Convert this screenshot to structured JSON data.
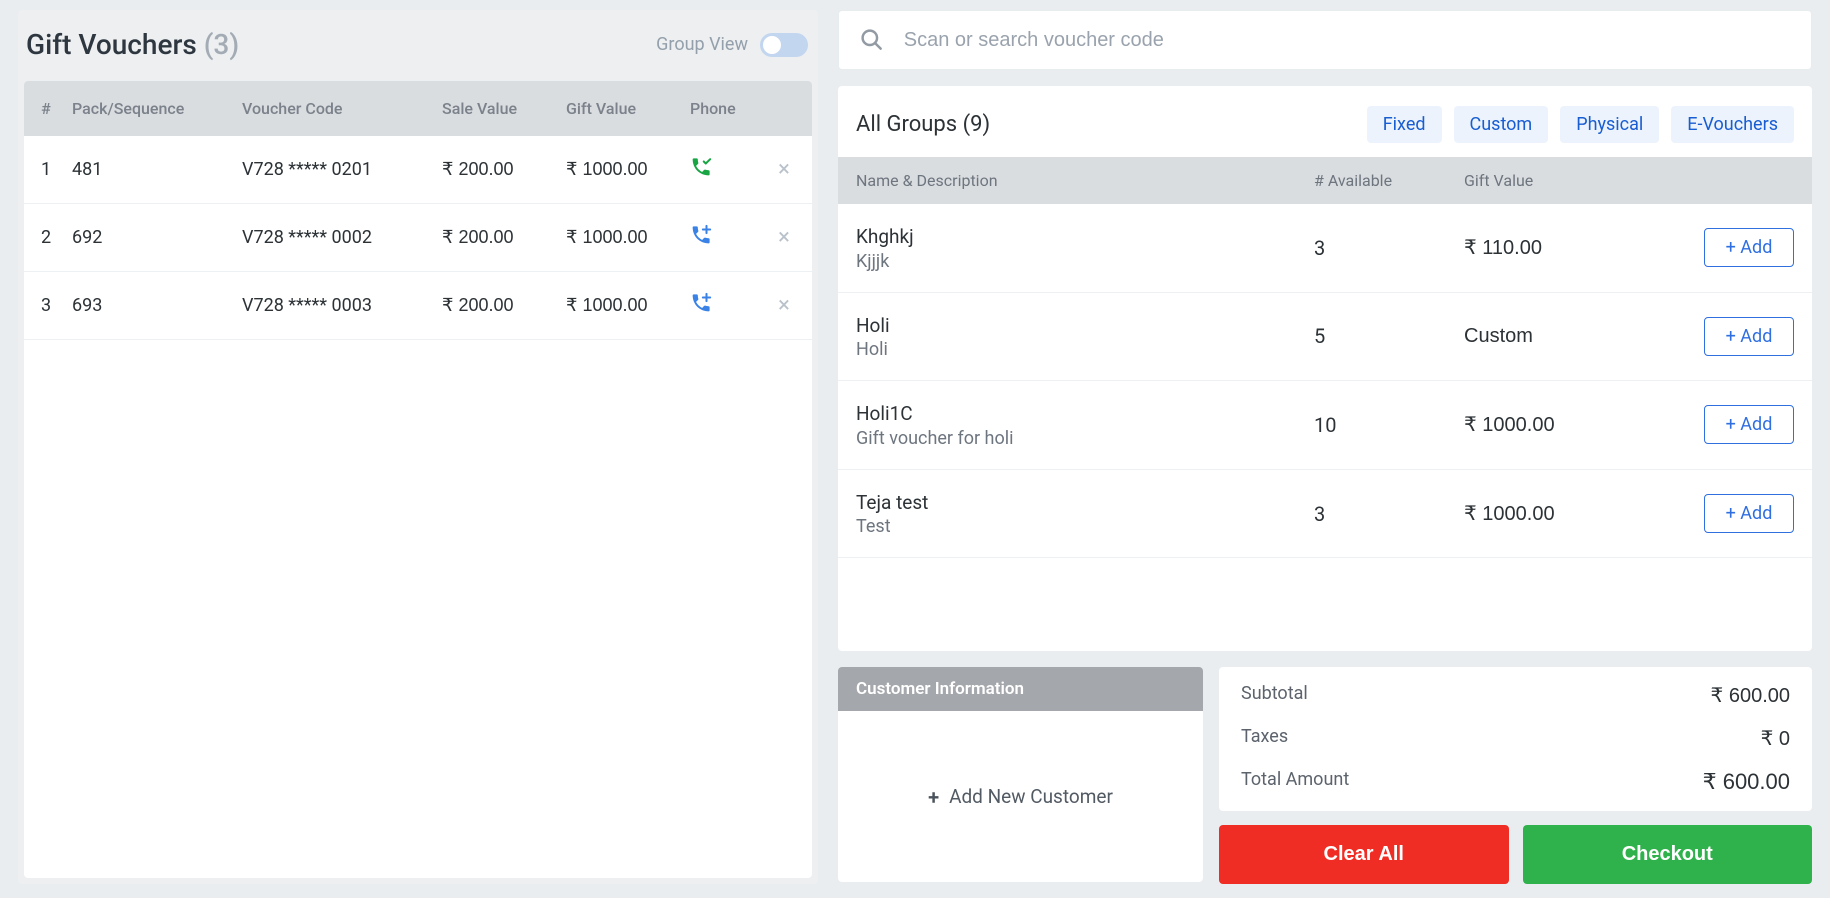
{
  "left": {
    "title": "Gift Vouchers",
    "count": "(3)",
    "group_view_label": "Group View",
    "headers": {
      "num": "#",
      "pack": "Pack/Sequence",
      "code": "Voucher Code",
      "sale": "Sale Value",
      "gift": "Gift Value",
      "phone": "Phone"
    },
    "rows": [
      {
        "num": "1",
        "pack": "481",
        "code": "V728 ***** 0201",
        "sale": "₹ 200.00",
        "gift": "₹ 1000.00",
        "phone_state": "verified"
      },
      {
        "num": "2",
        "pack": "692",
        "code": "V728 ***** 0002",
        "sale": "₹ 200.00",
        "gift": "₹ 1000.00",
        "phone_state": "add"
      },
      {
        "num": "3",
        "pack": "693",
        "code": "V728 ***** 0003",
        "sale": "₹ 200.00",
        "gift": "₹ 1000.00",
        "phone_state": "add"
      }
    ]
  },
  "search": {
    "placeholder": "Scan or search voucher code"
  },
  "groups": {
    "title": "All Groups (9)",
    "chips": {
      "fixed": "Fixed",
      "custom": "Custom",
      "physical": "Physical",
      "evouchers": "E-Vouchers"
    },
    "headers": {
      "name": "Name & Description",
      "avail": "# Available",
      "gift": "Gift Value"
    },
    "add_label": "+ Add",
    "rows": [
      {
        "name": "Khghkj",
        "desc": "Kjjjk",
        "avail": "3",
        "gift": "₹ 110.00"
      },
      {
        "name": "Holi",
        "desc": "Holi",
        "avail": "5",
        "gift": "Custom"
      },
      {
        "name": "Holi1C",
        "desc": "Gift voucher for holi",
        "avail": "10",
        "gift": "₹ 1000.00"
      },
      {
        "name": "Teja test",
        "desc": "Test",
        "avail": "3",
        "gift": "₹ 1000.00"
      }
    ]
  },
  "customer": {
    "title": "Customer Information",
    "add_label": "Add New Customer"
  },
  "totals": {
    "subtotal_label": "Subtotal",
    "subtotal_value": "₹ 600.00",
    "taxes_label": "Taxes",
    "taxes_value": "₹ 0",
    "total_label": "Total Amount",
    "total_value": "₹ 600.00"
  },
  "actions": {
    "clear": "Clear All",
    "checkout": "Checkout"
  }
}
